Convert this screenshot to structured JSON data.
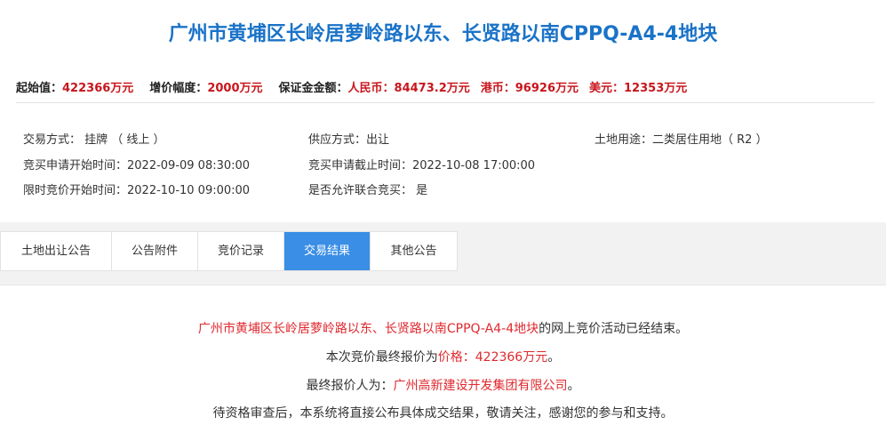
{
  "header": {
    "title": "广州市黄埔区长岭居萝岭路以东、长贤路以南CPPQ-A4-4地块"
  },
  "prices": {
    "start_label": "起始值：",
    "start_value": "422366万元",
    "increment_label": "增价幅度：",
    "increment_value": "2000万元",
    "deposit_label": "保证金金额：",
    "rmb_label": "人民币：",
    "rmb_value": "84473.2万元",
    "hkd_label": "港币：",
    "hkd_value": "96926万元",
    "usd_label": "美元：",
    "usd_value": "12353万元"
  },
  "info": {
    "trade_method": "交易方式： 挂牌 （ 线上 ）",
    "supply_method": "供应方式：出让",
    "land_use": "土地用途：二类居住用地（ R2 ）",
    "apply_start": "竞买申请开始时间：2022-09-09 08:30:00",
    "apply_end": "竞买申请截止时间：2022-10-08 17:00:00",
    "bid_start": "限时竞价开始时间：2022-10-10 09:00:00",
    "joint_bid": "是否允许联合竞买： 是"
  },
  "tabs": [
    {
      "label": "土地出让公告",
      "active": false
    },
    {
      "label": "公告附件",
      "active": false
    },
    {
      "label": "竞价记录",
      "active": false
    },
    {
      "label": "交易结果",
      "active": true
    },
    {
      "label": "其他公告",
      "active": false
    }
  ],
  "result": {
    "line1_land": "广州市黄埔区长岭居萝岭路以东、长贤路以南CPPQ-A4-4地块",
    "line1_rest": "的网上竞价活动已经结束。",
    "line2_prefix": "本次竞价最终报价为",
    "line2_price": "价格：422366万元",
    "line2_suffix": "。",
    "line3_prefix": "最终报价人为：",
    "line3_bidder": "广州高新建设开发集团有限公司",
    "line3_suffix": "。",
    "line4": "待资格审查后，本系统将直接公布具体成交结果，敬请关注，感谢您的参与和支持。"
  },
  "colors": {
    "title_blue": "#1a73c8",
    "price_red": "#c8161d",
    "active_tab": "#3a8ee6",
    "highlight_red": "#e0282e"
  }
}
